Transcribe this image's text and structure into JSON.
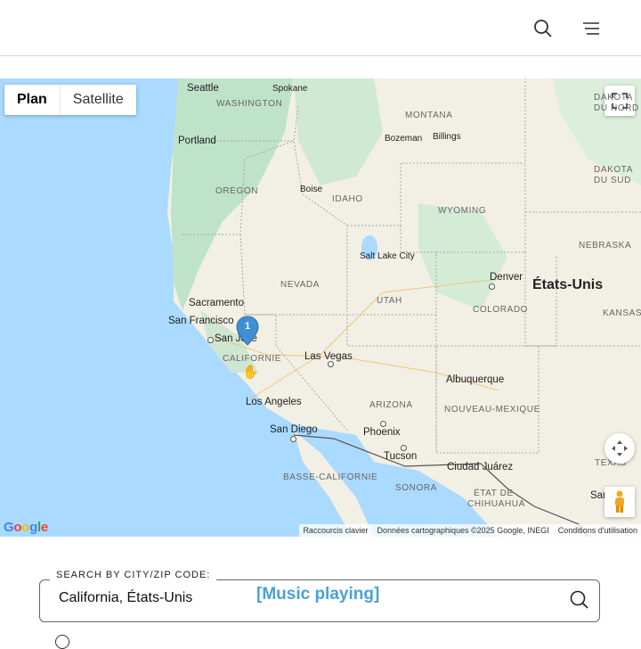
{
  "header": {
    "search_icon": "search-icon",
    "menu_icon": "hamburger-menu-icon"
  },
  "map": {
    "type_controls": {
      "plan_label": "Plan",
      "satellite_label": "Satellite",
      "active": "Plan"
    },
    "country_label": "États-Unis",
    "cities": {
      "seattle": "Seattle",
      "spokane": "Spokane",
      "portland": "Portland",
      "bozeman": "Bozeman",
      "billings": "Billings",
      "boise": "Boise",
      "salt_lake_city": "Salt Lake City",
      "denver": "Denver",
      "sacramento": "Sacramento",
      "san_francisco": "San Francisco",
      "san_jose": "San José",
      "las_vegas": "Las Vegas",
      "los_angeles": "Los Angeles",
      "san_diego": "San Diego",
      "phoenix": "Phoenix",
      "tucson": "Tucson",
      "albuquerque": "Albuquerque",
      "ciudad_juarez": "Ciudad Juárez",
      "san": "San"
    },
    "regions": {
      "washington": "WASHINGTON",
      "montana": "MONTANA",
      "dakota_du_nord_1": "DAKOTA",
      "dakota_du_nord_2": "DU NORD",
      "oregon": "OREGON",
      "idaho": "IDAHO",
      "wyoming": "WYOMING",
      "dakota_du_sud_1": "DAKOTA",
      "dakota_du_sud_2": "DU SUD",
      "nebraska": "NEBRASKA",
      "nevada": "NEVADA",
      "utah": "UTAH",
      "colorado": "COLORADO",
      "kansas": "KANSAS",
      "californie": "CALIFORNIE",
      "arizona": "ARIZONA",
      "nouveau_mexique": "NOUVEAU-MEXIQUE",
      "basse_californie": "BASSE-CALIFORNIE",
      "sonora": "SONORA",
      "etat_de_1": "ÉTAT DE",
      "etat_de_2": "CHIHUAHUA",
      "texas": "TEXAS"
    },
    "marker": {
      "count": "1"
    },
    "attribution": {
      "shortcuts": "Raccourcis clavier",
      "data": "Données cartographiques ©2025 Google, INEGI",
      "terms": "Conditions d'utilisation"
    },
    "logo": "Google",
    "colors": {
      "water": "#aadaff",
      "land": "#f2efe4",
      "forest": "#bfe3c8",
      "marker": "#3f8fd6"
    }
  },
  "search": {
    "label": "SEARCH BY CITY/ZIP CODE:",
    "value": "California, États-Unis"
  },
  "caption": "[Music playing]"
}
